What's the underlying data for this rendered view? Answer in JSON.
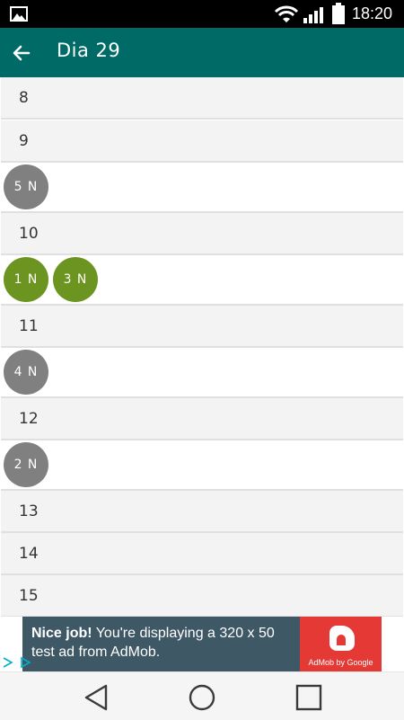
{
  "status_bar": {
    "time": "18:20",
    "icons": [
      "gallery-icon",
      "wifi-icon",
      "signal-icon",
      "battery-icon"
    ]
  },
  "app_bar": {
    "title": "Dia 29",
    "back_icon": "arrow-left-icon",
    "background": "#006b66"
  },
  "schedule": {
    "hours": [
      {
        "label": "8",
        "items": []
      },
      {
        "label": "9",
        "items": [
          {
            "label": "5 N",
            "color": "grey"
          }
        ]
      },
      {
        "label": "10",
        "items": [
          {
            "label": "1 N",
            "color": "green"
          },
          {
            "label": "3 N",
            "color": "green"
          }
        ]
      },
      {
        "label": "11",
        "items": [
          {
            "label": "4 N",
            "color": "grey"
          }
        ]
      },
      {
        "label": "12",
        "items": [
          {
            "label": "2 N",
            "color": "grey"
          }
        ]
      },
      {
        "label": "13",
        "items": []
      },
      {
        "label": "14",
        "items": []
      },
      {
        "label": "15",
        "items": []
      }
    ],
    "colors": {
      "grey": "#808080",
      "green": "#6b9420"
    }
  },
  "ad": {
    "headline": "Nice job!",
    "body": " You're displaying a 320 x 50 test ad from AdMob.",
    "logo_caption": "AdMob by Google",
    "background": "#3f5866",
    "logo_background": "#e53935"
  },
  "nav_bar": {
    "buttons": [
      "back-triangle-icon",
      "home-circle-icon",
      "recents-square-icon"
    ]
  }
}
